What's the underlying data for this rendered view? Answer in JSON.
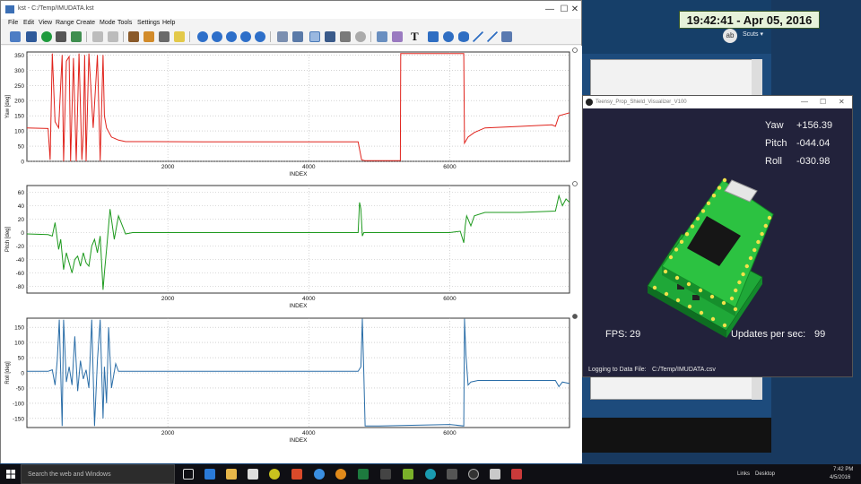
{
  "clock": "19:42:41 - Apr 05, 2016",
  "background_window": {
    "avatar_initial": "ab",
    "user_label": "Scuts ▾"
  },
  "plot_window": {
    "title": "kst - C:/Temp/IMUDATA.kst",
    "controls": {
      "minimize": "—",
      "maximize": "☐",
      "close": "✕"
    },
    "menu": [
      "File",
      "Edit",
      "View",
      "Range",
      "Create",
      "Mode",
      "Tools",
      "Settings",
      "Help"
    ],
    "toolbar_icons": [
      "print-icon",
      "save-icon",
      "reload-icon",
      "print2-icon",
      "export-icon",
      "undo-icon",
      "redo-icon",
      "data-wizard-icon",
      "edit-icon",
      "tied-zoom-icon",
      "label-icon",
      "back-icon",
      "forward-icon",
      "left-icon",
      "right-icon",
      "pause-icon",
      "zoom-icon",
      "layout-mode-icon",
      "pick-mode-icon",
      "crosshair-icon",
      "table-icon",
      "plot-icon",
      "text-icon",
      "rect-icon",
      "circle-icon",
      "ellipse-icon",
      "line-icon",
      "arrow-icon",
      "picture-icon"
    ],
    "text_tool": "T"
  },
  "chart_data": [
    {
      "type": "line",
      "title": "",
      "xlabel": "INDEX",
      "ylabel": "Yaw [deg]",
      "xlim": [
        0,
        7700
      ],
      "ylim": [
        0,
        360
      ],
      "xticks": [
        "2000",
        "4000",
        "6000"
      ],
      "yticks": [
        "0",
        "50",
        "100",
        "150",
        "200",
        "250",
        "300",
        "350"
      ],
      "grid": true,
      "series": [
        {
          "color": "#e0231c",
          "x": [
            0,
            300,
            330,
            360,
            400,
            450,
            500,
            520,
            560,
            600,
            620,
            660,
            700,
            740,
            780,
            800,
            820,
            840,
            880,
            940,
            1000,
            1040,
            1080,
            1100,
            1130,
            1200,
            1300,
            1400,
            1800,
            2500,
            3500,
            4700,
            4750,
            4800,
            5300,
            5305,
            5310,
            6200,
            6210,
            6260,
            6350,
            6500,
            7000,
            7450,
            7500,
            7550,
            7700
          ],
          "y": [
            110,
            108,
            5,
            355,
            130,
            110,
            350,
            0,
            330,
            345,
            0,
            340,
            0,
            355,
            5,
            90,
            350,
            0,
            355,
            110,
            350,
            2,
            350,
            150,
            110,
            80,
            70,
            65,
            65,
            64,
            64,
            64,
            5,
            2,
            2,
            355,
            355,
            355,
            60,
            80,
            95,
            110,
            115,
            120,
            115,
            150,
            160
          ]
        }
      ]
    },
    {
      "type": "line",
      "title": "",
      "xlabel": "INDEX",
      "ylabel": "Pitch [deg]",
      "xlim": [
        0,
        7700
      ],
      "ylim": [
        -90,
        70
      ],
      "xticks": [
        "2000",
        "4000",
        "6000"
      ],
      "yticks": [
        "60",
        "40",
        "20",
        "0",
        "-20",
        "-40",
        "-60",
        "-80"
      ],
      "grid": true,
      "series": [
        {
          "color": "#1e9a1e",
          "x": [
            0,
            300,
            360,
            400,
            450,
            480,
            520,
            560,
            600,
            640,
            680,
            720,
            760,
            800,
            840,
            880,
            920,
            960,
            1000,
            1040,
            1080,
            1100,
            1130,
            1180,
            1240,
            1300,
            1400,
            1500,
            2000,
            3000,
            4000,
            4700,
            4720,
            4740,
            4760,
            4780,
            4800,
            5000,
            6000,
            6150,
            6200,
            6220,
            6240,
            6300,
            6350,
            6500,
            7000,
            7500,
            7550,
            7600,
            7650,
            7700
          ],
          "y": [
            -2,
            -3,
            -5,
            15,
            -25,
            -10,
            -55,
            -30,
            -45,
            -60,
            -40,
            -35,
            -50,
            -30,
            -45,
            -50,
            -20,
            -10,
            -30,
            -5,
            -85,
            -60,
            -25,
            35,
            -10,
            25,
            -2,
            0,
            0,
            0,
            0,
            0,
            45,
            35,
            -5,
            0,
            0,
            0,
            0,
            2,
            -15,
            10,
            25,
            10,
            25,
            30,
            30,
            32,
            55,
            40,
            50,
            45
          ]
        }
      ]
    },
    {
      "type": "line",
      "title": "",
      "xlabel": "INDEX",
      "ylabel": "Roll [deg]",
      "xlim": [
        0,
        7700
      ],
      "ylim": [
        -180,
        180
      ],
      "xticks": [
        "2000",
        "4000",
        "6000"
      ],
      "yticks": [
        "150",
        "100",
        "50",
        "0",
        "-50",
        "-100",
        "-150"
      ],
      "grid": true,
      "series": [
        {
          "color": "#2b6ea8",
          "x": [
            0,
            300,
            360,
            400,
            430,
            460,
            480,
            500,
            520,
            560,
            600,
            640,
            680,
            720,
            760,
            800,
            840,
            880,
            920,
            960,
            1000,
            1040,
            1080,
            1100,
            1130,
            1160,
            1200,
            1260,
            1300,
            1400,
            2000,
            3000,
            4000,
            4700,
            4740,
            4760,
            4780,
            4800,
            4820,
            5000,
            6000,
            6200,
            6210,
            6230,
            6260,
            6300,
            6400,
            7000,
            7500,
            7550,
            7600,
            7700
          ],
          "y": [
            5,
            5,
            10,
            -40,
            40,
            175,
            0,
            -175,
            175,
            -30,
            20,
            -40,
            120,
            -60,
            40,
            -20,
            10,
            -50,
            175,
            -175,
            40,
            175,
            -150,
            20,
            -100,
            150,
            -50,
            30,
            5,
            5,
            5,
            5,
            5,
            5,
            20,
            178,
            5,
            -175,
            -175,
            -175,
            -170,
            -175,
            178,
            60,
            -40,
            -30,
            -25,
            -25,
            -25,
            -45,
            -30,
            -35
          ]
        }
      ]
    }
  ],
  "visualizer": {
    "title": "Teensy_Prop_Shield_Visualizer_V100",
    "yaw_label": "Yaw",
    "yaw_value": "+156.39",
    "pitch_label": "Pitch",
    "pitch_value": "-044.04",
    "roll_label": "Roll",
    "roll_value": "-030.98",
    "fps_label": "FPS:",
    "fps_value": "29",
    "ups_label": "Updates per sec:",
    "ups_value": "99",
    "log_label": "Logging to Data File:",
    "log_path": "C:/Temp/IMUDATA.csv"
  },
  "taskbar": {
    "search_placeholder": "Search the web and Windows",
    "tray_links": "Links",
    "tray_desktop": "Desktop",
    "time": "7:42 PM",
    "date": "4/5/2016"
  }
}
